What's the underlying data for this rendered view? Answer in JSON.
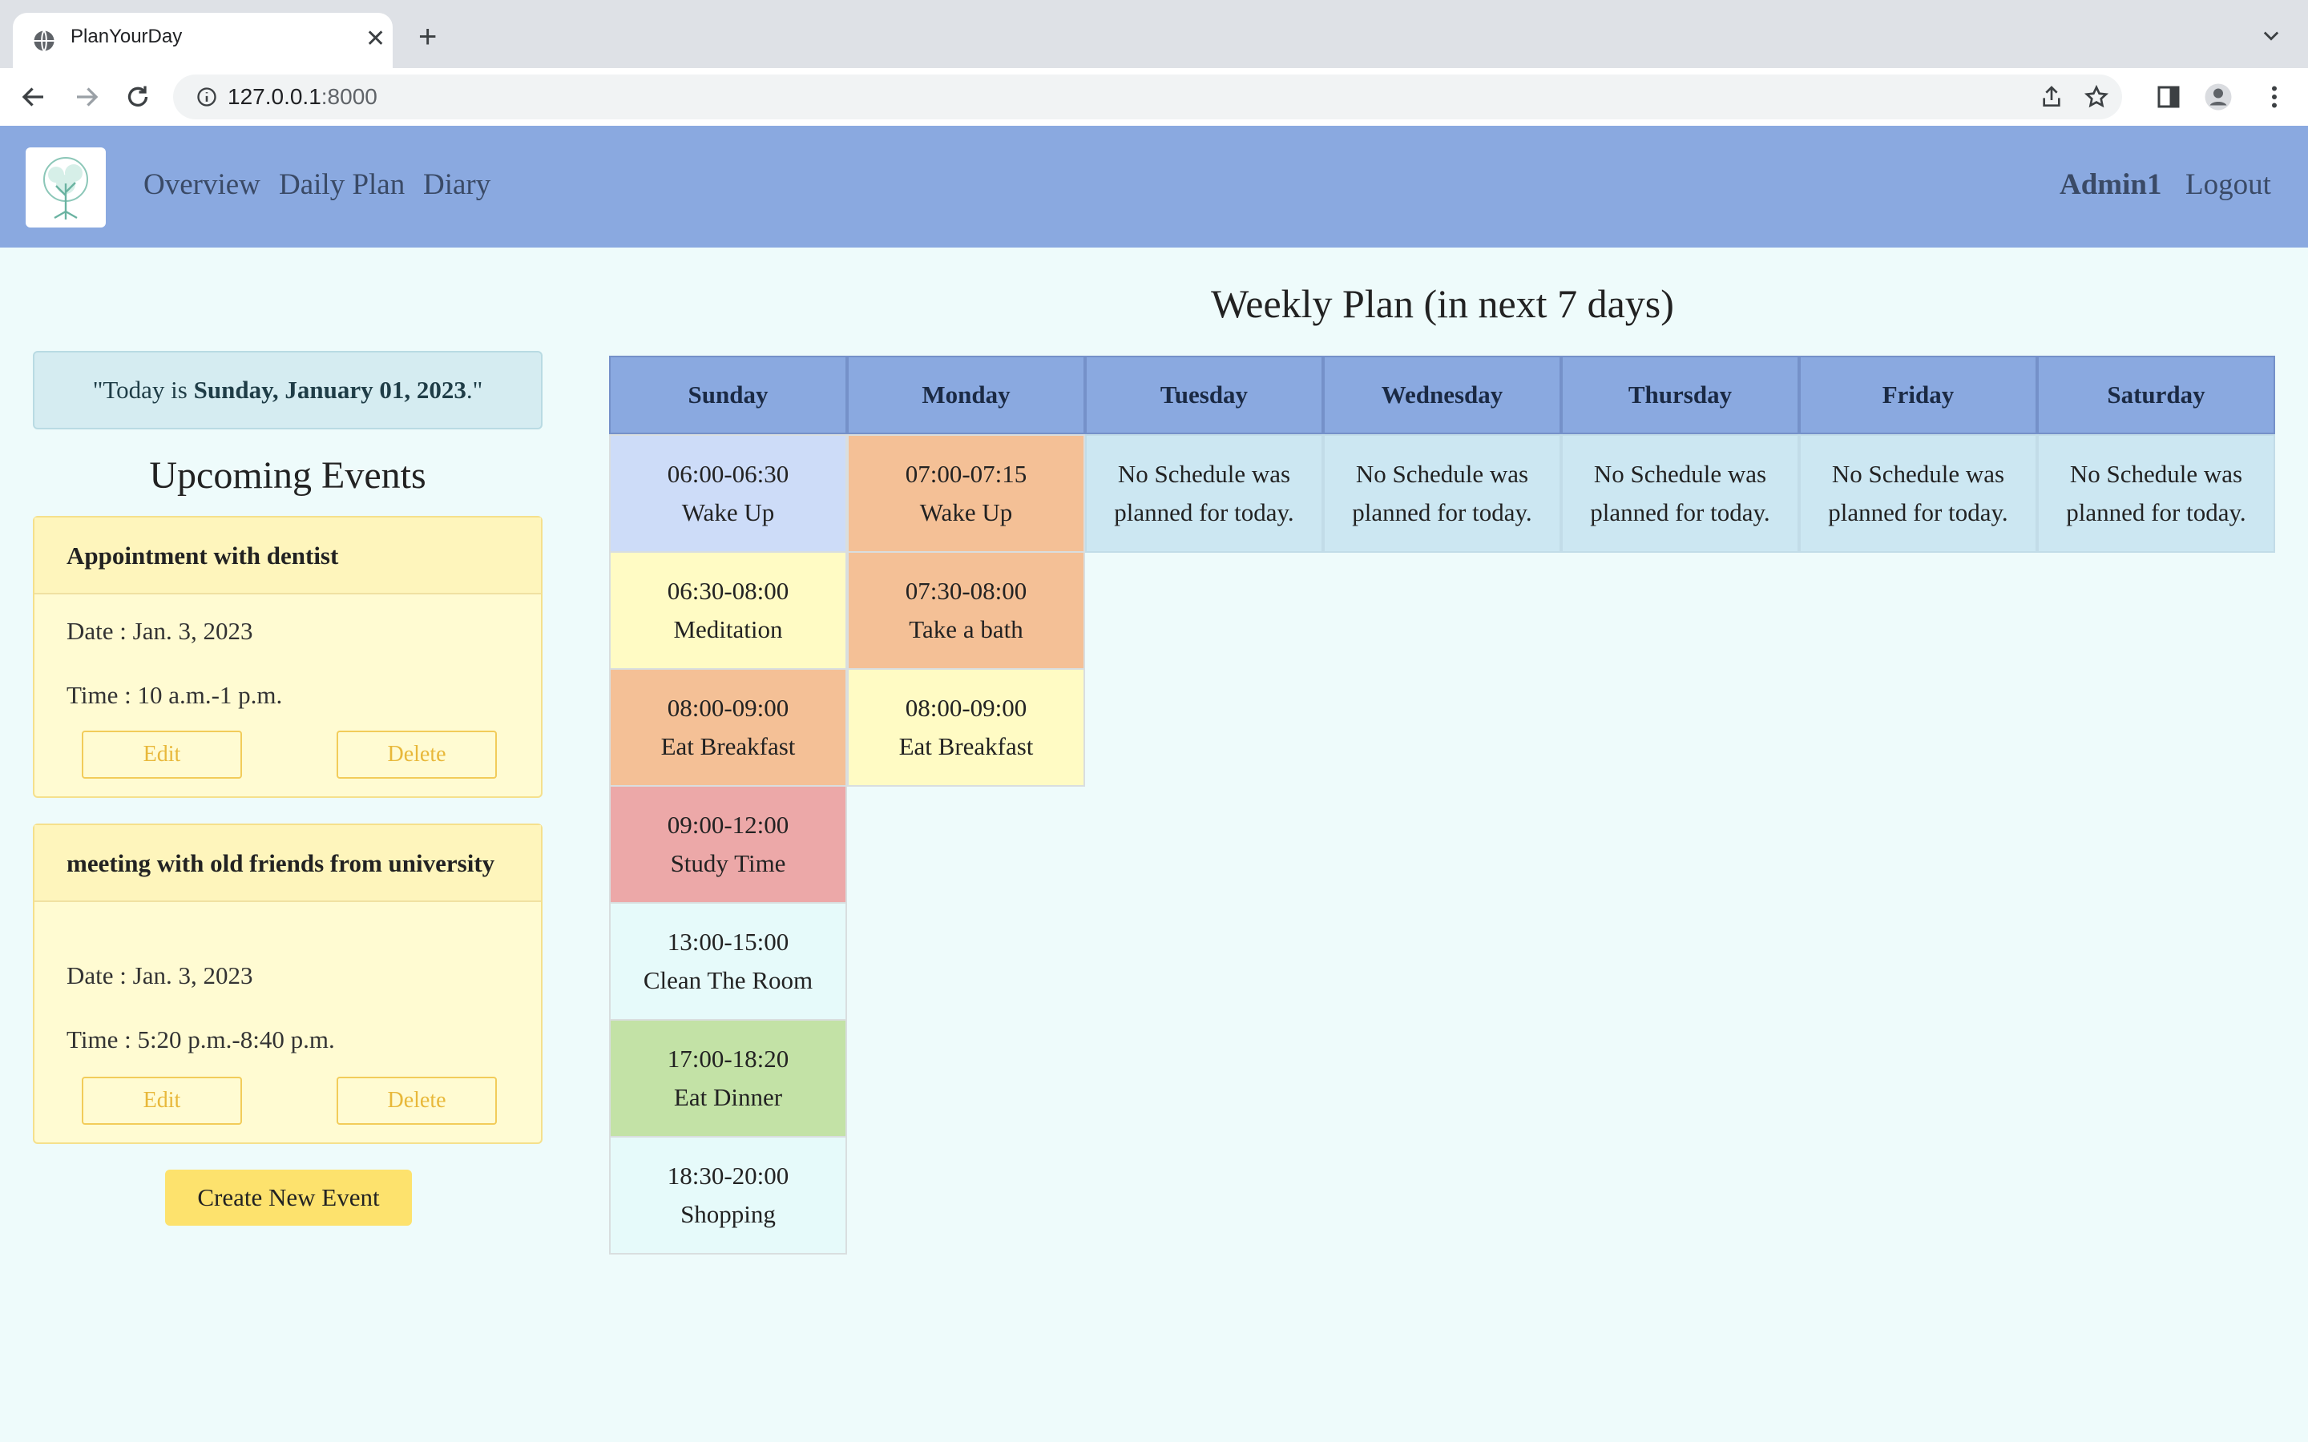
{
  "browser": {
    "tab_title": "PlanYourDay",
    "url_host": "127.0.0.1",
    "url_port": ":8000"
  },
  "nav": {
    "links": [
      "Overview",
      "Daily Plan",
      "Diary"
    ],
    "user": "Admin1",
    "logout": "Logout"
  },
  "today": {
    "prefix": "\"Today is ",
    "date": "Sunday, January 01, 2023",
    "suffix": ".\""
  },
  "upcoming_title": "Upcoming Events",
  "events": [
    {
      "title": "Appointment with dentist",
      "date": "Date : Jan. 3, 2023",
      "time": "Time : 10 a.m.-1 p.m.",
      "edit": "Edit",
      "delete": "Delete"
    },
    {
      "title": "meeting with old friends from university",
      "date": "Date : Jan. 3, 2023",
      "time": "Time : 5:20 p.m.-8:40 p.m.",
      "edit": "Edit",
      "delete": "Delete"
    }
  ],
  "create_button": "Create New Event",
  "weekly": {
    "title": "Weekly Plan (in next 7 days)",
    "days": [
      "Sunday",
      "Monday",
      "Tuesday",
      "Wednesday",
      "Thursday",
      "Friday",
      "Saturday"
    ],
    "no_schedule": [
      "No Schedule was",
      "planned for today."
    ],
    "schedule": [
      [
        {
          "time": "06:00-06:30",
          "task": "Wake Up",
          "color": "#cddcf8"
        },
        {
          "time": "06:30-08:00",
          "task": "Meditation",
          "color": "#fffbc4"
        },
        {
          "time": "08:00-09:00",
          "task": "Eat Breakfast",
          "color": "#f4c096"
        },
        {
          "time": "09:00-12:00",
          "task": "Study Time",
          "color": "#eca8a8"
        },
        {
          "time": "13:00-15:00",
          "task": "Clean The Room",
          "color": "#e6fafa"
        },
        {
          "time": "17:00-18:20",
          "task": "Eat Dinner",
          "color": "#c3e2a6"
        },
        {
          "time": "18:30-20:00",
          "task": "Shopping",
          "color": "#e6fafa"
        }
      ],
      [
        {
          "time": "07:00-07:15",
          "task": "Wake Up",
          "color": "#f4c096"
        },
        {
          "time": "07:30-08:00",
          "task": "Take a bath",
          "color": "#f4c096"
        },
        {
          "time": "08:00-09:00",
          "task": "Eat Breakfast",
          "color": "#fffbc4"
        }
      ],
      [],
      [],
      [],
      [],
      []
    ]
  }
}
